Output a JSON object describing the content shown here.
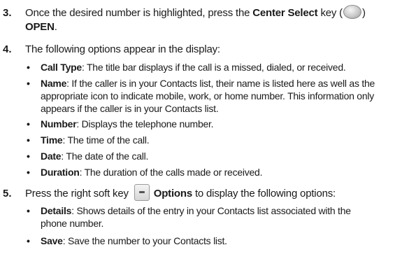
{
  "steps": [
    {
      "number": "3.",
      "line1_pre": "Once the desired number is highlighted, press the ",
      "line1_bold": "Center Select",
      "line1_post": " key (",
      "line1_close": ")",
      "line2_bold": "OPEN",
      "line2_post": "."
    },
    {
      "number": "4.",
      "text": "The following options appear in the display:"
    },
    {
      "number": "5.",
      "pre": "Press the right soft key ",
      "bold": "Options",
      "post": " to display the following options:"
    }
  ],
  "options": [
    {
      "term": "Call Type",
      "desc": ": The title bar displays if the call is a missed, dialed, or received."
    },
    {
      "term": "Name",
      "desc": ": If the caller is in your Contacts list, their name is listed here as well as the",
      "wrap": [
        "appropriate icon to indicate mobile, work, or home number. This information only",
        "appears if the caller is in your Contacts list."
      ]
    },
    {
      "term": "Number",
      "desc": ": Displays the telephone number."
    },
    {
      "term": "Time",
      "desc": ": The time of the call."
    },
    {
      "term": "Date",
      "desc": ": The date of the call."
    },
    {
      "term": "Duration",
      "desc": ": The duration of the calls made or received."
    }
  ],
  "sub_options": [
    {
      "term": "Details",
      "desc": ": Shows details of the entry in your Contacts list associated with the",
      "wrap": [
        "phone number."
      ]
    },
    {
      "term": "Save",
      "desc": ": Save the number to your Contacts list."
    }
  ],
  "bullet_char": "•"
}
